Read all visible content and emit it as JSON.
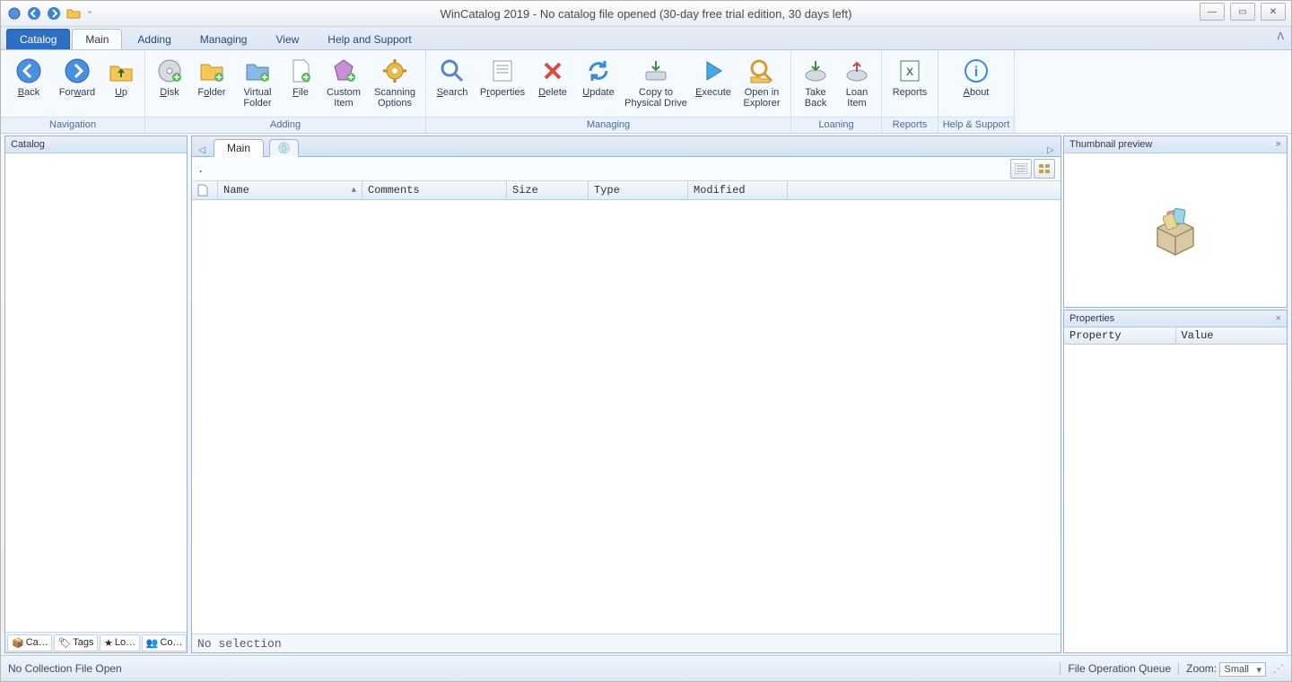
{
  "title": "WinCatalog 2019 - No catalog file opened (30-day free trial edition, 30 days left)",
  "tabs": {
    "file": "Catalog",
    "main": "Main",
    "adding": "Adding",
    "managing": "Managing",
    "view": "View",
    "help": "Help and Support"
  },
  "ribbon": {
    "navigation": {
      "label": "Navigation",
      "back": "Back",
      "forward": "Forward",
      "up": "Up"
    },
    "adding": {
      "label": "Adding",
      "disk": "Disk",
      "folder": "Folder",
      "vfolder": "Virtual\nFolder",
      "file": "File",
      "custom": "Custom\nItem",
      "scan": "Scanning\nOptions"
    },
    "managing": {
      "label": "Managing",
      "search": "Search",
      "properties": "Properties",
      "delete": "Delete",
      "update": "Update",
      "copy": "Copy to\nPhysical Drive",
      "execute": "Execute",
      "open": "Open in\nExplorer"
    },
    "loaning": {
      "label": "Loaning",
      "take": "Take\nBack",
      "loan": "Loan\nItem"
    },
    "reports": {
      "label": "Reports",
      "reports": "Reports"
    },
    "help": {
      "label": "Help & Support",
      "about": "About"
    }
  },
  "left": {
    "title": "Catalog",
    "tabs": [
      "Ca…",
      "Tags",
      "Lo…",
      "Co…"
    ]
  },
  "center": {
    "tab_main": "Main",
    "path": " .",
    "columns": {
      "name": "Name",
      "comments": "Comments",
      "size": "Size",
      "type": "Type",
      "modified": "Modified"
    },
    "no_selection": "No selection"
  },
  "right": {
    "thumb": "Thumbnail preview",
    "props": "Properties",
    "prop_col": "Property",
    "val_col": "Value"
  },
  "status": {
    "left": "No Collection File Open",
    "queue": "File Operation Queue",
    "zoom_label": "Zoom:",
    "zoom_value": "Small"
  }
}
